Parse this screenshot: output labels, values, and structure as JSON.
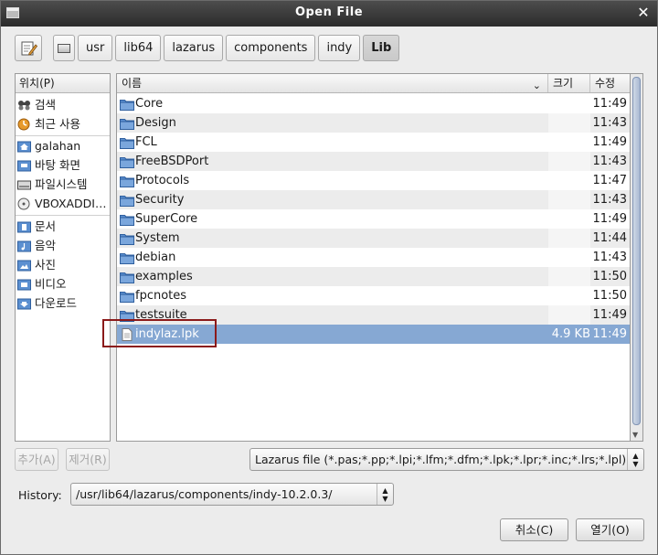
{
  "window": {
    "title": "Open File"
  },
  "path": {
    "crumbs": [
      "usr",
      "lib64",
      "lazarus",
      "components",
      "indy",
      "Lib"
    ]
  },
  "places": {
    "header": "위치(P)",
    "items": [
      {
        "label": "검색",
        "icon": "search-icon"
      },
      {
        "label": "최근 사용",
        "icon": "recent-icon"
      },
      {
        "label": "galahan",
        "icon": "home-folder-icon"
      },
      {
        "label": "바탕 화면",
        "icon": "desktop-folder-icon"
      },
      {
        "label": "파일시스템",
        "icon": "drive-icon"
      },
      {
        "label": "VBOXADDI…",
        "icon": "cdrom-icon"
      },
      {
        "label": "문서",
        "icon": "documents-folder-icon"
      },
      {
        "label": "음악",
        "icon": "music-folder-icon"
      },
      {
        "label": "사진",
        "icon": "pictures-folder-icon"
      },
      {
        "label": "비디오",
        "icon": "videos-folder-icon"
      },
      {
        "label": "다운로드",
        "icon": "downloads-folder-icon"
      }
    ]
  },
  "files": {
    "columns": {
      "name": "이름",
      "size": "크기",
      "modified": "수정"
    },
    "rows": [
      {
        "name": "Core",
        "size": "",
        "modified": "11:49",
        "type": "folder"
      },
      {
        "name": "Design",
        "size": "",
        "modified": "11:43",
        "type": "folder"
      },
      {
        "name": "FCL",
        "size": "",
        "modified": "11:49",
        "type": "folder"
      },
      {
        "name": "FreeBSDPort",
        "size": "",
        "modified": "11:43",
        "type": "folder"
      },
      {
        "name": "Protocols",
        "size": "",
        "modified": "11:47",
        "type": "folder"
      },
      {
        "name": "Security",
        "size": "",
        "modified": "11:43",
        "type": "folder"
      },
      {
        "name": "SuperCore",
        "size": "",
        "modified": "11:49",
        "type": "folder"
      },
      {
        "name": "System",
        "size": "",
        "modified": "11:44",
        "type": "folder"
      },
      {
        "name": "debian",
        "size": "",
        "modified": "11:43",
        "type": "folder"
      },
      {
        "name": "examples",
        "size": "",
        "modified": "11:50",
        "type": "folder"
      },
      {
        "name": "fpcnotes",
        "size": "",
        "modified": "11:50",
        "type": "folder"
      },
      {
        "name": "testsuite",
        "size": "",
        "modified": "11:49",
        "type": "folder"
      },
      {
        "name": "indylaz.lpk",
        "size": "4.9 KB",
        "modified": "11:49",
        "type": "file",
        "selected": true
      }
    ]
  },
  "actions": {
    "add": "추가(A)",
    "remove": "제거(R)",
    "cancel": "취소(C)",
    "open": "열기(O)"
  },
  "filter": {
    "value": "Lazarus file (*.pas;*.pp;*.lpi;*.lfm;*.dfm;*.lpk;*.lpr;*.inc;*.lrs;*.lpl)"
  },
  "history": {
    "label": "History:",
    "value": "/usr/lib64/lazarus/components/indy-10.2.0.3/"
  },
  "colors": {
    "selection": "#86a8d3",
    "highlight_box": "#8b1a1a",
    "folder": "#5b8fd0"
  }
}
